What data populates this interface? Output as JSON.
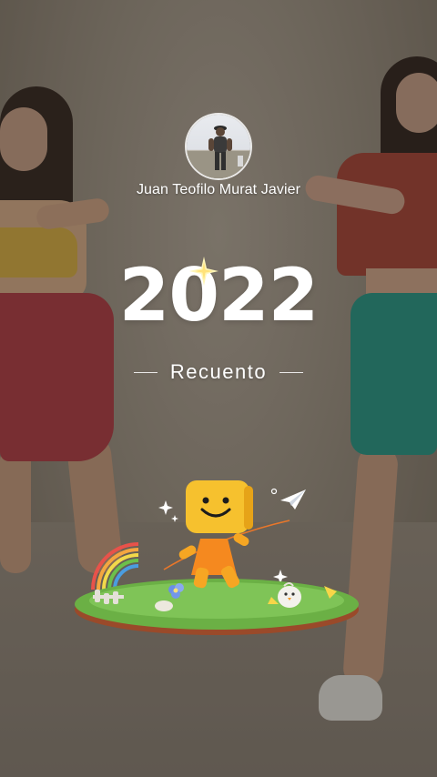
{
  "user": {
    "name": "Juan Teofilo Murat Javier",
    "avatar_icon": "profile-photo"
  },
  "recap": {
    "year": "2022",
    "subtitle": "Recuento"
  },
  "illustration": {
    "icons": [
      "mascot-icon",
      "paper-plane-icon",
      "rainbow-icon",
      "sparkle-icon",
      "grass-island-icon",
      "chick-icon",
      "flower-icon"
    ]
  },
  "colors": {
    "text": "#ffffff",
    "mascot": "#f6a623",
    "grass": "#6bb045",
    "skirt_left": "#a4343c",
    "skirt_right": "#1f8a7c"
  }
}
